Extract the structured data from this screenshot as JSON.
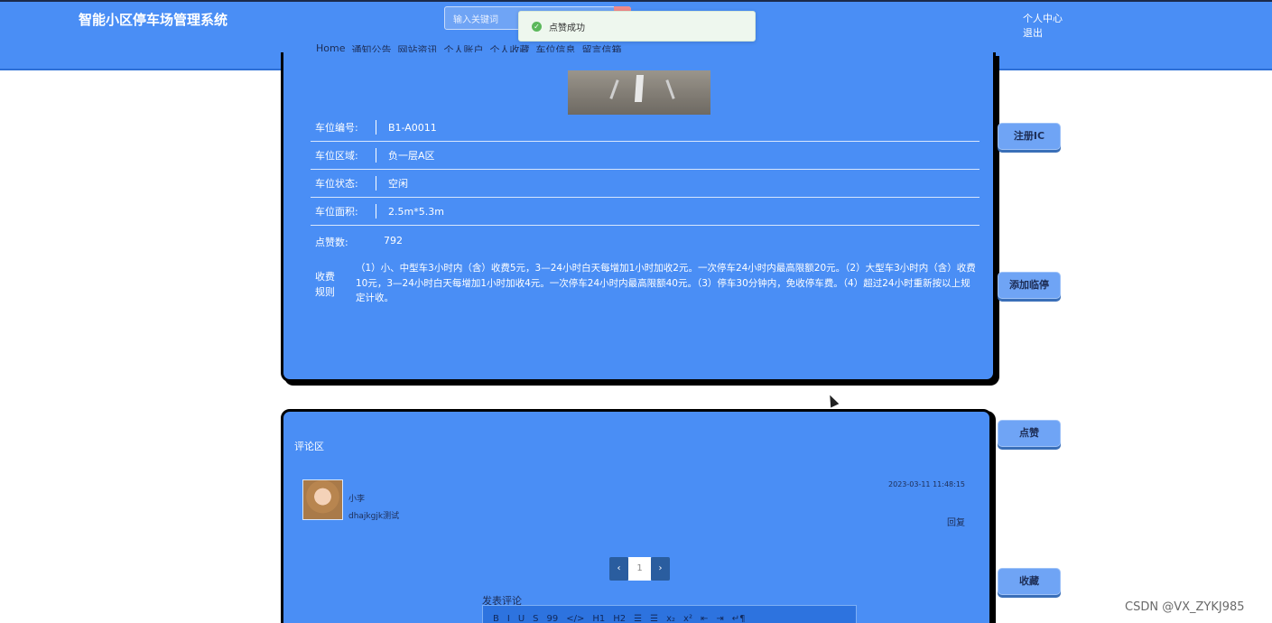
{
  "header": {
    "site_title": "智能小区停车场管理系统",
    "search_placeholder": "输入关键词",
    "nav": [
      "Home",
      "通知公告",
      "网站资讯",
      "个人账户",
      "个人收藏",
      "车位信息",
      "留言信箱"
    ],
    "user_center": "个人中心",
    "logout": "退出"
  },
  "toast": {
    "message": "点赞成功"
  },
  "detail": {
    "fields": [
      {
        "label": "车位编号:",
        "value": "B1-A0011"
      },
      {
        "label": "车位区域:",
        "value": "负一层A区"
      },
      {
        "label": "车位状态:",
        "value": "空闲"
      },
      {
        "label": "车位面积:",
        "value": "2.5m*5.3m"
      }
    ],
    "likes_label": "点赞数:",
    "likes_value": "792",
    "rule_label": "收费规则",
    "rule_text": "（1）小、中型车3小时内（含）收费5元，3—24小时白天每增加1小时加收2元。一次停车24小时内最高限额20元。（2）大型车3小时内（含）收费10元，3—24小时白天每增加1小时加收4元。一次停车24小时内最高限额40元。（3）停车30分钟内，免收停车费。（4）超过24小时重新按以上规定计收。"
  },
  "side_buttons": {
    "register_ic": "注册IC",
    "add_temp": "添加临停",
    "like": "点赞",
    "favorite": "收藏"
  },
  "comments": {
    "title": "评论区",
    "items": [
      {
        "user": "小李",
        "content": "dhajkgjk测试",
        "time": "2023-03-11 11:48:15",
        "reply": "回复"
      }
    ],
    "pager": {
      "prev": "‹",
      "current": "1",
      "next": "›"
    },
    "post_label": "发表评论",
    "toolbar": [
      "B",
      "I",
      "U",
      "S",
      "99",
      "</>",
      "H1",
      "H2",
      "☰",
      "☰",
      "x₂",
      "x²",
      "⇤",
      "⇥",
      "↵¶"
    ]
  },
  "watermark": "CSDN @VX_ZYKJ985"
}
